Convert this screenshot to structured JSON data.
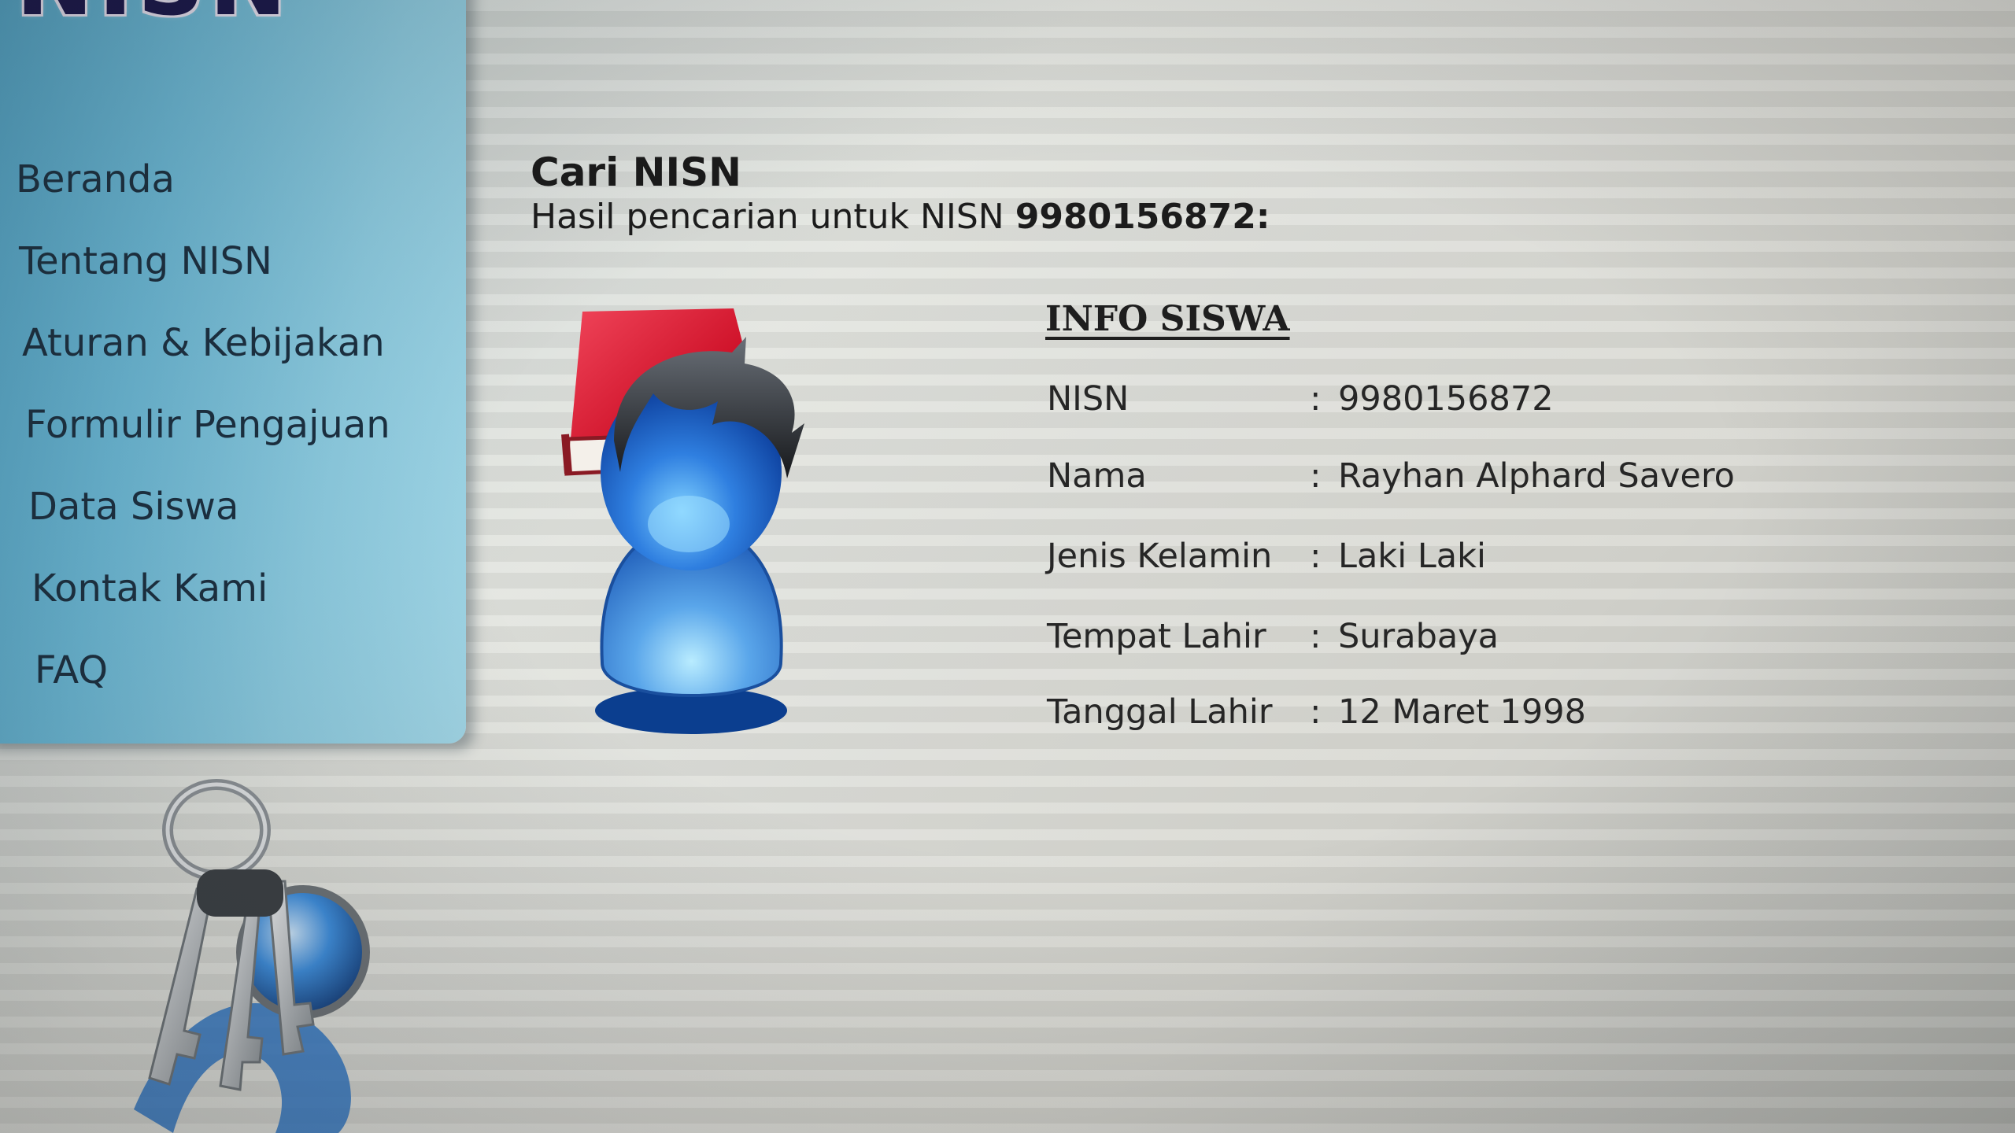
{
  "site": {
    "logo_text": "NISN"
  },
  "sidebar": {
    "items": [
      {
        "label": "Beranda"
      },
      {
        "label": "Tentang NISN"
      },
      {
        "label": "Aturan & Kebijakan"
      },
      {
        "label": "Formulir Pengajuan"
      },
      {
        "label": "Data Siswa"
      },
      {
        "label": "Kontak Kami"
      },
      {
        "label": "FAQ"
      }
    ]
  },
  "main": {
    "title": "Cari NISN",
    "result_prefix": "Hasil pencarian untuk NISN",
    "result_nisn": "9980156872",
    "result_suffix": ":",
    "info": {
      "heading": "INFO SISWA",
      "rows": [
        {
          "label": "NISN",
          "separator": ":",
          "value": "9980156872"
        },
        {
          "label": "Nama",
          "separator": ":",
          "value": "Rayhan Alphard Savero"
        },
        {
          "label": "Jenis Kelamin",
          "separator": ":",
          "value": "Laki Laki"
        },
        {
          "label": "Tempat Lahir",
          "separator": ":",
          "value": "Surabaya"
        },
        {
          "label": "Tanggal Lahir",
          "separator": ":",
          "value": "12 Maret 1998"
        }
      ]
    }
  },
  "icons": {
    "avatar": "student-avatar-icon",
    "book": "book-icon",
    "keyring": "keyring-icon"
  },
  "colors": {
    "sidebar": "#6bbad8",
    "logo": "#17144a",
    "book": "#d8192c",
    "avatar": "#2e7fd8"
  }
}
